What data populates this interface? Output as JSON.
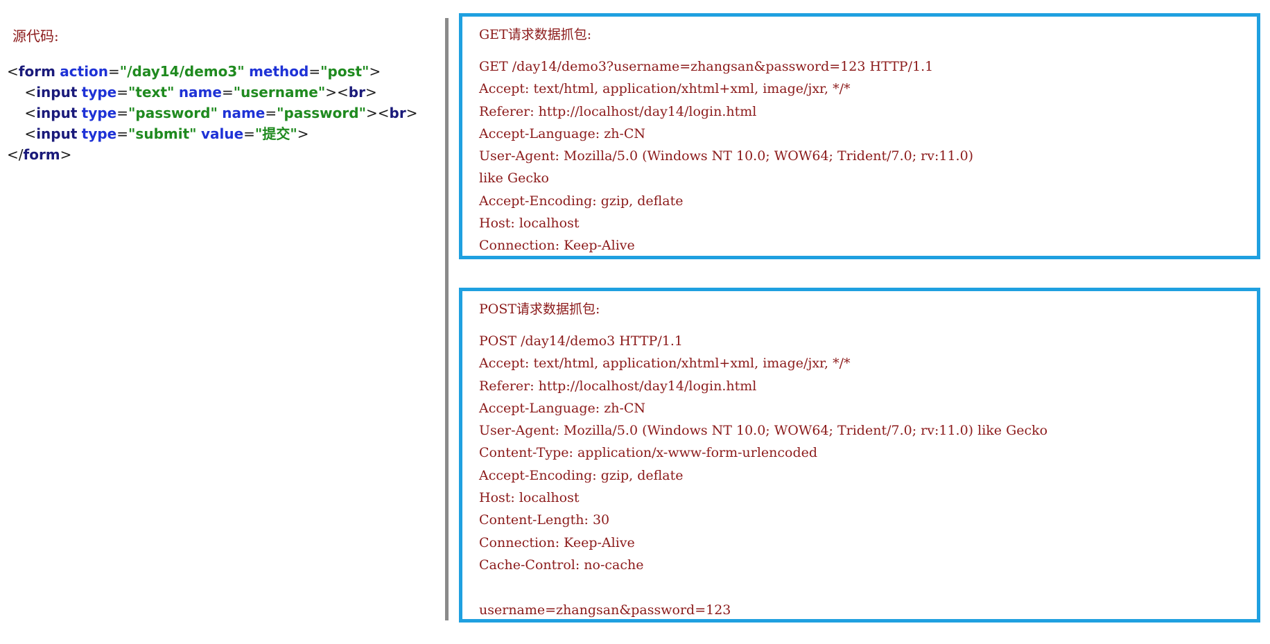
{
  "source": {
    "title": "源代码:",
    "lines": [
      [
        {
          "t": "<",
          "c": "punct"
        },
        {
          "t": "form",
          "c": "tag"
        },
        {
          "t": " ",
          "c": "punct"
        },
        {
          "t": "action",
          "c": "attr"
        },
        {
          "t": "=",
          "c": "punct"
        },
        {
          "t": "\"/day14/demo3\"",
          "c": "val"
        },
        {
          "t": " ",
          "c": "punct"
        },
        {
          "t": "method",
          "c": "attr"
        },
        {
          "t": "=",
          "c": "punct"
        },
        {
          "t": "\"post\"",
          "c": "val"
        },
        {
          "t": ">",
          "c": "punct"
        }
      ],
      [
        {
          "t": "    <",
          "c": "punct"
        },
        {
          "t": "input",
          "c": "tag"
        },
        {
          "t": " ",
          "c": "punct"
        },
        {
          "t": "type",
          "c": "attr"
        },
        {
          "t": "=",
          "c": "punct"
        },
        {
          "t": "\"text\"",
          "c": "val"
        },
        {
          "t": " ",
          "c": "punct"
        },
        {
          "t": "name",
          "c": "attr"
        },
        {
          "t": "=",
          "c": "punct"
        },
        {
          "t": "\"username\"",
          "c": "val"
        },
        {
          "t": "><",
          "c": "punct"
        },
        {
          "t": "br",
          "c": "tag"
        },
        {
          "t": ">",
          "c": "punct"
        }
      ],
      [
        {
          "t": "    <",
          "c": "punct"
        },
        {
          "t": "input",
          "c": "tag"
        },
        {
          "t": " ",
          "c": "punct"
        },
        {
          "t": "type",
          "c": "attr"
        },
        {
          "t": "=",
          "c": "punct"
        },
        {
          "t": "\"password\"",
          "c": "val"
        },
        {
          "t": " ",
          "c": "punct"
        },
        {
          "t": "name",
          "c": "attr"
        },
        {
          "t": "=",
          "c": "punct"
        },
        {
          "t": "\"password\"",
          "c": "val"
        },
        {
          "t": "><",
          "c": "punct"
        },
        {
          "t": "br",
          "c": "tag"
        },
        {
          "t": ">",
          "c": "punct"
        }
      ],
      [
        {
          "t": "    <",
          "c": "punct"
        },
        {
          "t": "input",
          "c": "tag"
        },
        {
          "t": " ",
          "c": "punct"
        },
        {
          "t": "type",
          "c": "attr"
        },
        {
          "t": "=",
          "c": "punct"
        },
        {
          "t": "\"submit\"",
          "c": "val"
        },
        {
          "t": " ",
          "c": "punct"
        },
        {
          "t": "value",
          "c": "attr"
        },
        {
          "t": "=",
          "c": "punct"
        },
        {
          "t": "\"提交\"",
          "c": "val"
        },
        {
          "t": ">",
          "c": "punct"
        }
      ],
      [
        {
          "t": "</",
          "c": "punct"
        },
        {
          "t": "form",
          "c": "tag"
        },
        {
          "t": ">",
          "c": "punct"
        }
      ]
    ]
  },
  "get_capture": {
    "title": "GET请求数据抓包:",
    "lines": [
      "GET /day14/demo3?username=zhangsan&password=123 HTTP/1.1",
      "Accept: text/html, application/xhtml+xml, image/jxr, */*",
      "Referer: http://localhost/day14/login.html",
      "Accept-Language: zh-CN",
      "User-Agent: Mozilla/5.0 (Windows NT 10.0; WOW64; Trident/7.0; rv:11.0)",
      "like Gecko",
      "Accept-Encoding: gzip, deflate",
      "Host: localhost",
      "Connection: Keep-Alive"
    ]
  },
  "post_capture": {
    "title": "POST请求数据抓包:",
    "lines": [
      "POST /day14/demo3 HTTP/1.1",
      "Accept: text/html, application/xhtml+xml, image/jxr, */*",
      "Referer: http://localhost/day14/login.html",
      "Accept-Language: zh-CN",
      "User-Agent: Mozilla/5.0 (Windows NT 10.0; WOW64; Trident/7.0; rv:11.0) like Gecko",
      "Content-Type: application/x-www-form-urlencoded",
      "Accept-Encoding: gzip, deflate",
      "Host: localhost",
      "Content-Length: 30",
      "Connection: Keep-Alive",
      "Cache-Control: no-cache",
      "",
      "username=zhangsan&password=123"
    ]
  },
  "colors": {
    "text": "#8b1a1a",
    "box_border": "#1fa0e0",
    "divider": "#8a8a8a",
    "code_tag": "#1a1a7a",
    "code_attr": "#1e32d6",
    "code_value": "#1f8a1f"
  }
}
